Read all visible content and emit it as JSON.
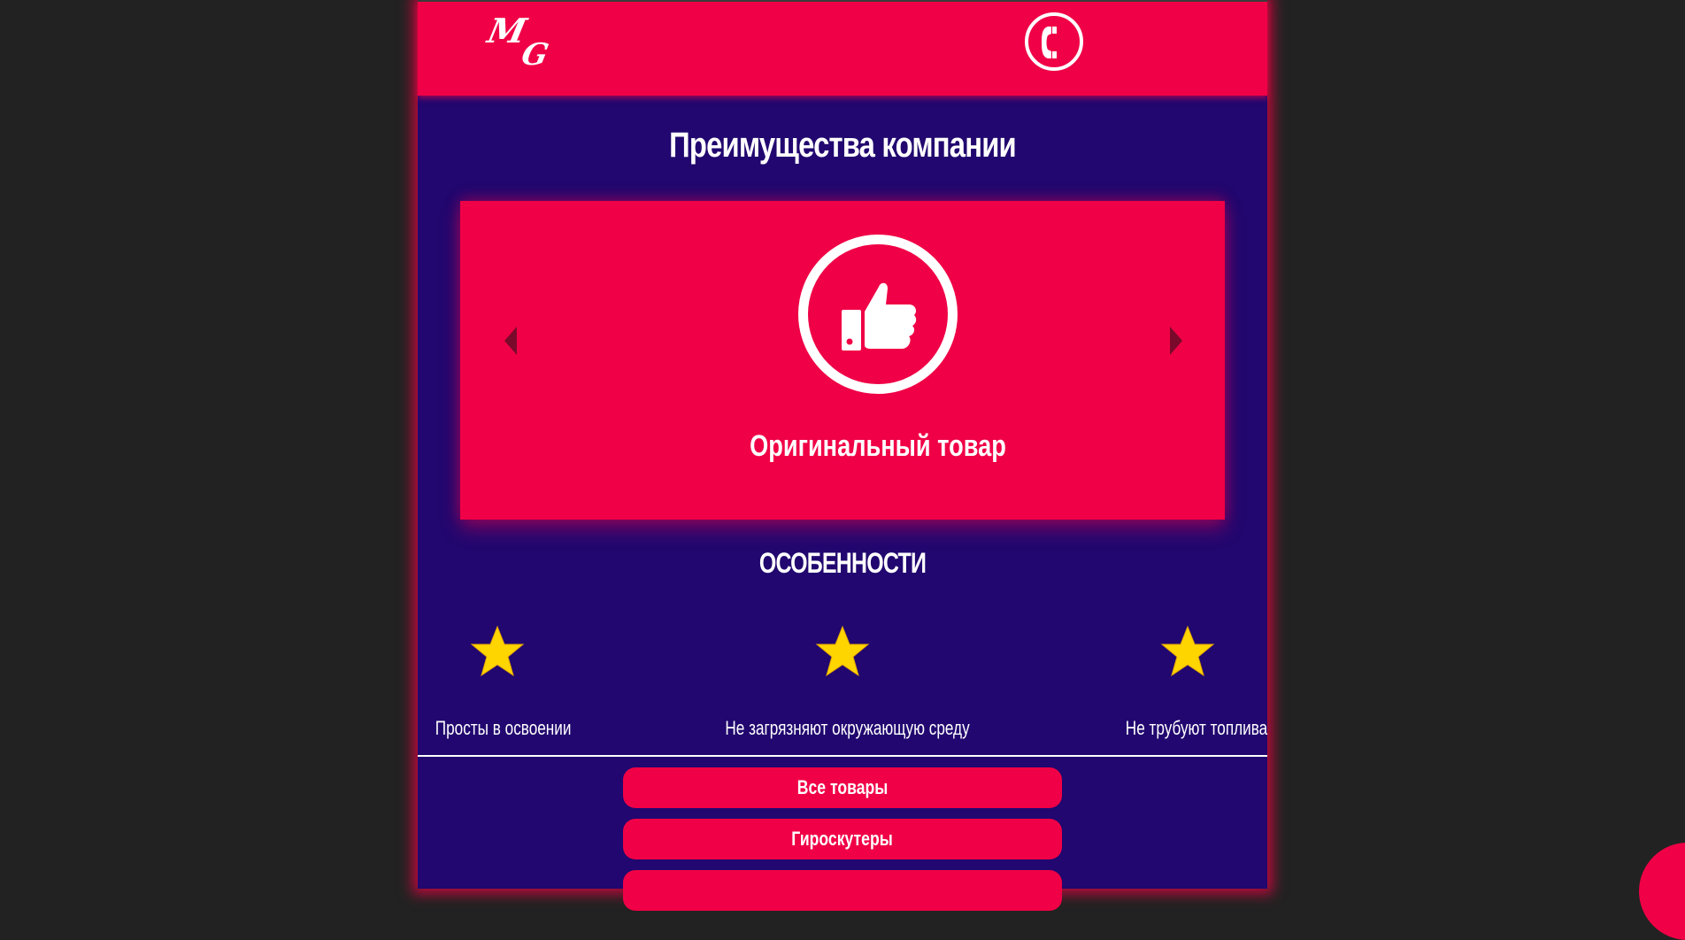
{
  "header": {
    "logo_m": "M",
    "logo_g": "G",
    "phone_icon": "phone-icon"
  },
  "advantages": {
    "title": "Преимущества компании",
    "slide": {
      "icon": "thumbs-up-icon",
      "caption": "Оригинальный товар"
    }
  },
  "features": {
    "title": "ОСОБЕННОСТИ",
    "items": [
      {
        "icon": "star-icon",
        "label": "Просты в освоении"
      },
      {
        "icon": "star-icon",
        "label": "Не загрязняют окружающую среду"
      },
      {
        "icon": "star-icon",
        "label": "Не трубуют топлива"
      }
    ]
  },
  "menu": {
    "items": [
      {
        "label": "Все товары"
      },
      {
        "label": "Гироскутеры"
      },
      {
        "label": ""
      }
    ]
  },
  "colors": {
    "background": "#222222",
    "page": "#21076f",
    "accent": "#f00046",
    "star": "#ffd500"
  }
}
